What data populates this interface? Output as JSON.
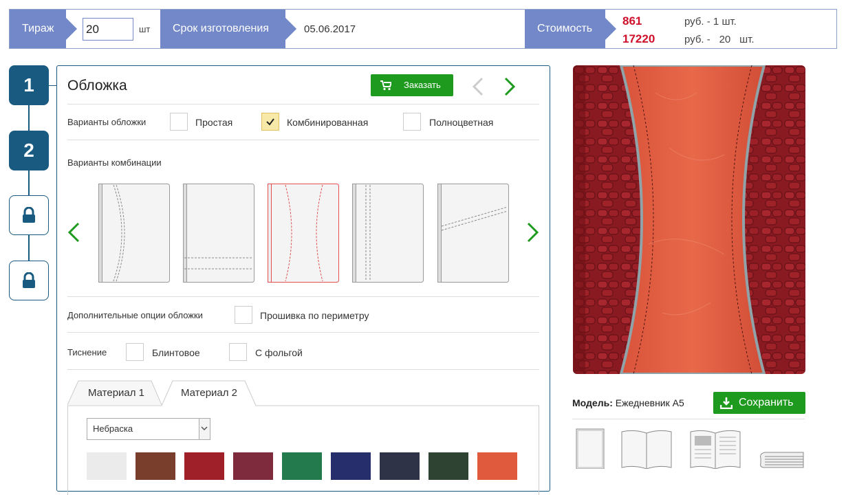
{
  "topbar": {
    "circulation_label": "Тираж",
    "circulation_value": "20",
    "circulation_unit": "шт",
    "deadline_label": "Срок изготовления",
    "deadline_value": "05.06.2017",
    "cost_label": "Стоимость",
    "price_unit": "861",
    "price_unit_note": "руб. - 1 шт.",
    "price_total": "17220",
    "price_total_note_prefix": "руб. -",
    "price_total_qty": "20",
    "price_total_note_suffix": "шт."
  },
  "steps": [
    {
      "label": "1",
      "state": "active"
    },
    {
      "label": "2",
      "state": "active"
    },
    {
      "label": "",
      "state": "locked",
      "icon": "lock-icon"
    },
    {
      "label": "",
      "state": "locked",
      "icon": "lock-icon"
    }
  ],
  "panel": {
    "title": "Обложка",
    "order_button": "Заказать",
    "cover_variants_label": "Варианты обложки",
    "cover_variants": [
      {
        "label": "Простая",
        "checked": false
      },
      {
        "label": "Комбинированная",
        "checked": true
      },
      {
        "label": "Полноцветная",
        "checked": false
      }
    ],
    "combination_label": "Варианты комбинации",
    "extra_options_label": "Дополнительные опции обложки",
    "extra_option": {
      "label": "Прошивка по периметру",
      "checked": false
    },
    "embossing_label": "Тиснение",
    "embossing": [
      {
        "label": "Блинтовое",
        "checked": false
      },
      {
        "label": "С фольгой",
        "checked": false
      }
    ],
    "tabs": [
      "Материал 1",
      "Материал 2"
    ],
    "active_tab": "Материал 2",
    "material_select": "Небраска",
    "swatch_colors": [
      "#ebebeb",
      "#7a3f2c",
      "#a0202a",
      "#7e2b3d",
      "#237a4c",
      "#262f6b",
      "#2f3347",
      "#2e4332",
      "#e05a3e"
    ]
  },
  "sidebar": {
    "model_label": "Модель:",
    "model_value": "Ежедневник А5",
    "save_button": "Сохранить",
    "accent": "#1e9a1e"
  }
}
